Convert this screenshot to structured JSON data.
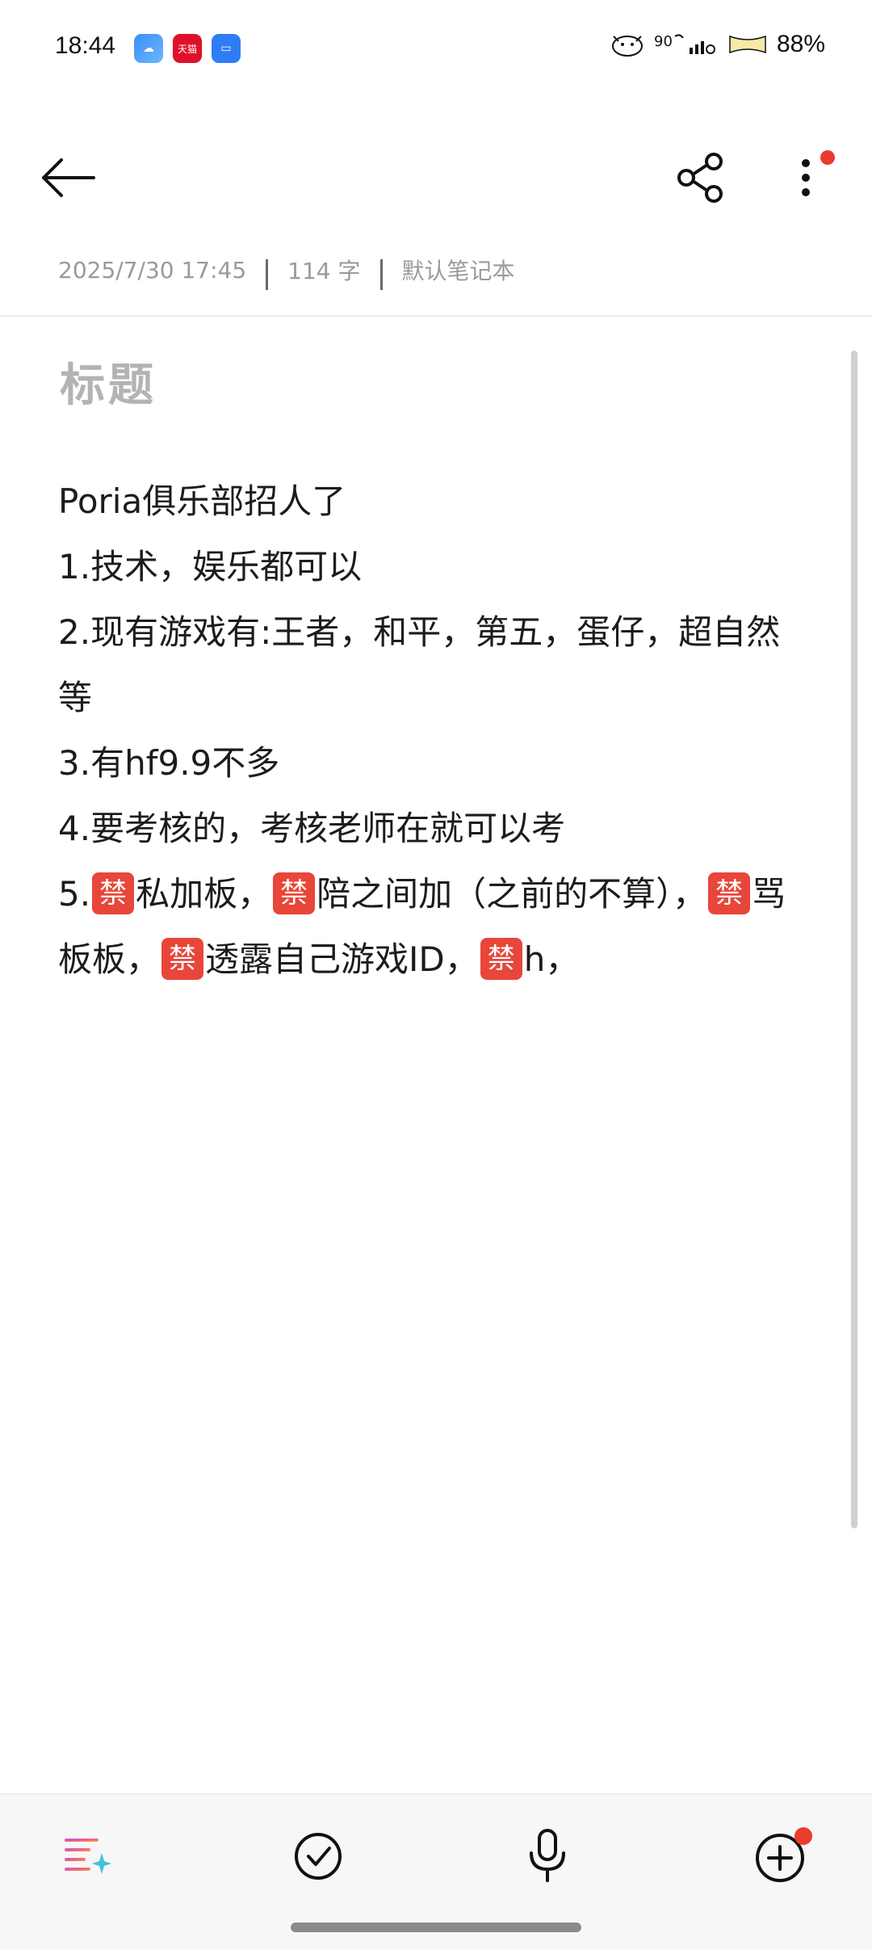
{
  "status_bar": {
    "time": "18:44",
    "apps": [
      {
        "name": "weather-app-icon",
        "glyph": "☁"
      },
      {
        "name": "tmall-app-icon",
        "glyph": "天猫"
      },
      {
        "name": "files-app-icon",
        "glyph": "▭"
      }
    ],
    "battery_percent": "88%"
  },
  "toolbar": {
    "back_icon": "arrow-left-icon",
    "share_icon": "share-icon",
    "more_icon": "more-vertical-icon",
    "notification_color": "#ea3b2f"
  },
  "meta": {
    "datetime": "2025/7/30 17:45",
    "word_count": "114 字",
    "notebook": "默认笔记本"
  },
  "note": {
    "title_placeholder": "标题",
    "ban_glyph": "禁",
    "lines": {
      "l1": "Poria俱乐部招人了",
      "l2": "1.技术，娱乐都可以",
      "l3": "2.现有游戏有:王者，和平，第五，蛋仔，超自然等",
      "l4": "3.有hf9.9不多",
      "l5": "4.要考核的，考核老师在就可以考",
      "l6a": "5.",
      "l6b": "私加板，",
      "l6c": "陪之间加（之前的不算），",
      "l6d": "骂板板，",
      "l6e": "透露自己游戏ID，",
      "l6f": "h，"
    }
  },
  "bottom_bar": {
    "buttons": [
      "ai-format-icon",
      "checklist-icon",
      "microphone-icon",
      "add-icon"
    ]
  },
  "colors": {
    "accent_red": "#ea3b2f",
    "ban_red": "#e8463a"
  }
}
